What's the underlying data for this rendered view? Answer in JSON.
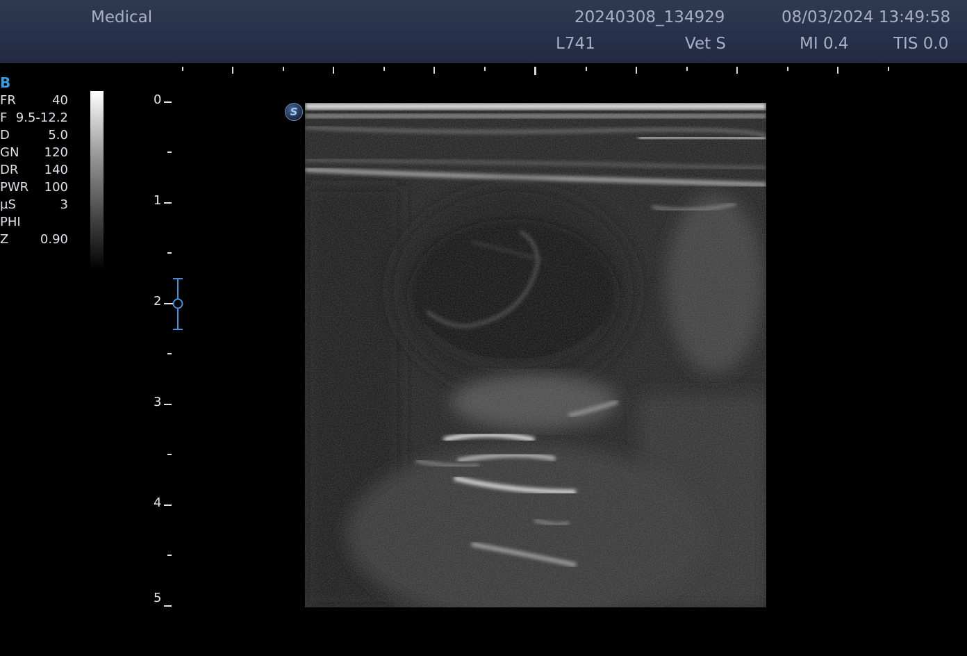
{
  "header": {
    "app_name": "Medical",
    "exam_id": "20240308_134929",
    "datetime": "08/03/2024 13:49:58",
    "probe": "L741",
    "preset": "Vet S",
    "mi": "MI 0.4",
    "tis": "TIS 0.0"
  },
  "params": {
    "mode": "B",
    "rows": [
      {
        "key": "FR",
        "value": "40"
      },
      {
        "key": "F",
        "value": "9.5-12.2"
      },
      {
        "key": "D",
        "value": "5.0"
      },
      {
        "key": "GN",
        "value": "120"
      },
      {
        "key": "DR",
        "value": "140"
      },
      {
        "key": "PWR",
        "value": "100"
      },
      {
        "key": "µS",
        "value": "3"
      },
      {
        "key": "PHI",
        "value": ""
      },
      {
        "key": "Z",
        "value": "0.90"
      }
    ]
  },
  "depth_scale": {
    "labels": [
      "0",
      "1",
      "2",
      "3",
      "4",
      "5"
    ]
  },
  "icons": {
    "sono_badge": "S"
  },
  "colors": {
    "header_bg": "#2a3450",
    "header_text": "#a9afc6",
    "mode_accent": "#3d9be0",
    "focus_marker": "#4a8fd6"
  }
}
